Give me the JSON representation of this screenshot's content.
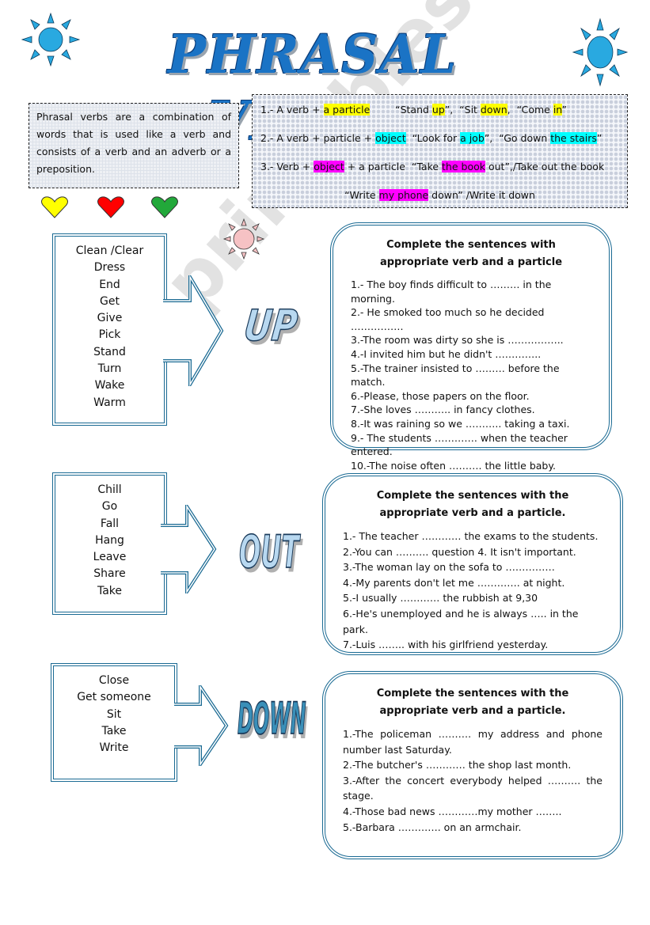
{
  "title": "PHRASAL VERBS",
  "definition": "Phrasal verbs are a combination of words that is used like a verb and consists of a verb and an adverb or a preposition.",
  "rules": [
    {
      "parts": [
        {
          "text": "1.- A verb + ",
          "hl": ""
        },
        {
          "text": "a particle",
          "hl": "yellow"
        },
        {
          "text": "        “Stand ",
          "hl": ""
        },
        {
          "text": "up",
          "hl": "yellow"
        },
        {
          "text": "”,  “Sit ",
          "hl": ""
        },
        {
          "text": "down",
          "hl": "yellow"
        },
        {
          "text": ",  “Come ",
          "hl": ""
        },
        {
          "text": "in",
          "hl": "yellow"
        },
        {
          "text": "”",
          "hl": ""
        }
      ]
    },
    {
      "parts": [
        {
          "text": "2.- A verb + particle + ",
          "hl": ""
        },
        {
          "text": "object",
          "hl": "cyan"
        },
        {
          "text": "  “Look for ",
          "hl": ""
        },
        {
          "text": "a job",
          "hl": "cyan"
        },
        {
          "text": "”,  “Go down ",
          "hl": ""
        },
        {
          "text": "the stairs",
          "hl": "cyan"
        },
        {
          "text": "”",
          "hl": ""
        }
      ]
    },
    {
      "parts": [
        {
          "text": "3.- Verb + ",
          "hl": ""
        },
        {
          "text": "object",
          "hl": "magenta"
        },
        {
          "text": " + a particle  “Take ",
          "hl": ""
        },
        {
          "text": "the book",
          "hl": "magenta"
        },
        {
          "text": " out”,/Take out the book",
          "hl": ""
        }
      ]
    },
    {
      "parts": [
        {
          "text": "“Write ",
          "hl": ""
        },
        {
          "text": "my phone",
          "hl": "magenta"
        },
        {
          "text": " down” /Write it down",
          "hl": ""
        }
      ]
    }
  ],
  "hearts": [
    {
      "name": "yellow-heart-icon",
      "color": "#ffff00"
    },
    {
      "name": "red-heart-icon",
      "color": "#ff0000"
    },
    {
      "name": "green-heart-icon",
      "color": "#22a83a"
    }
  ],
  "sections": [
    {
      "particle": "UP",
      "verbs": [
        "Clean /Clear",
        "Dress",
        "End",
        "Get",
        "Give",
        "Pick",
        "Stand",
        "Turn",
        "Wake",
        "Warm"
      ],
      "exercise_title": "Complete the sentences with appropriate verb and a particle",
      "items": [
        "1.- The boy finds difficult to ……… in the morning.",
        "2.- He smoked too much so he decided …………….",
        "3.-The room was dirty so she is ……………..",
        "4.-I invited him but he didn't …………..",
        "5.-The trainer insisted to ……… before the match.",
        "6.-Please, those papers on the floor.",
        "7.-She loves ……….. in fancy clothes.",
        "8.-It was raining so we ……….. taking a taxi.",
        "9.- The students …………. when the teacher entered.",
        "10.-The noise  often ……….  the little baby."
      ]
    },
    {
      "particle": "OUT",
      "verbs": [
        "Chill",
        "Go",
        "Fall",
        "Hang",
        "Leave",
        "Share",
        "Take"
      ],
      "exercise_title": "Complete the sentences with the appropriate verb and a particle.",
      "items": [
        "1.- The teacher ………… the exams to the students.",
        "2.-You can ………. question 4. It isn't important.",
        "3.-The woman lay on the sofa to ……………",
        "4.-My parents don't let me …………. at night.",
        "5.-I usually ………… the rubbish at 9,30",
        "6.-He's unemployed and he is always ….. in the park.",
        "7.-Luis …….. with his girlfriend yesterday."
      ]
    },
    {
      "particle": "DOWN",
      "verbs": [
        "Close",
        "Get someone",
        "Sit",
        "Take",
        "Write"
      ],
      "exercise_title": "Complete the sentences with the appropriate verb and a particle.",
      "items": [
        "1.-The policeman ………. my address and phone number last Saturday.",
        "2.-The butcher's ………… the shop last month.",
        "3.-After the concert everybody helped ………. the stage.",
        "4.-Those bad news …………my mother ……..",
        "5.-Barbara …………. on an armchair."
      ]
    }
  ],
  "watermark": "ESLprintables.com"
}
